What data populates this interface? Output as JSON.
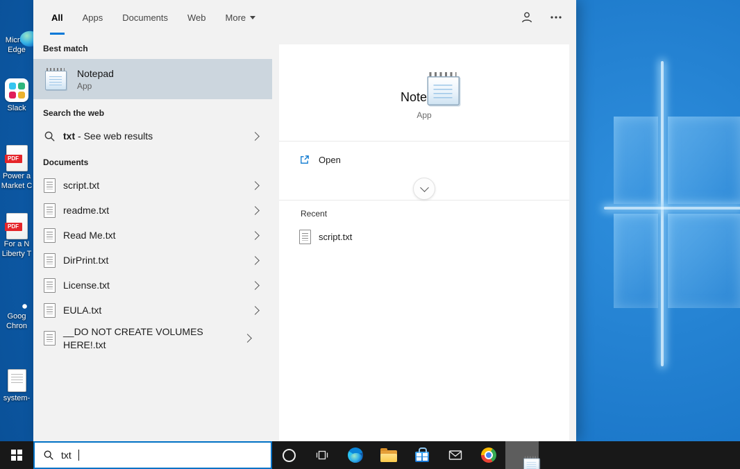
{
  "colors": {
    "accent": "#0078d7",
    "best_match_highlight": "#ccd6de",
    "taskbar": "#181818"
  },
  "header": {
    "tabs": [
      {
        "label": "All"
      },
      {
        "label": "Apps"
      },
      {
        "label": "Documents"
      },
      {
        "label": "Web"
      },
      {
        "label": "More"
      }
    ],
    "active_tab": "All",
    "icons": [
      "signin-icon",
      "ellipsis-icon"
    ]
  },
  "left_pane": {
    "best_match": {
      "label": "Best match",
      "item": {
        "title": "Notepad",
        "subtitle": "App",
        "icon": "notepad-icon"
      }
    },
    "search_the_web": {
      "label": "Search the web",
      "item": {
        "query": "txt",
        "rest": " - See web results",
        "icon": "search-icon"
      }
    },
    "documents": {
      "label": "Documents",
      "items": [
        {
          "title": "script.txt",
          "icon": "text-file-icon"
        },
        {
          "title": "readme.txt",
          "icon": "text-file-icon"
        },
        {
          "title": "Read Me.txt",
          "icon": "text-file-icon"
        },
        {
          "title": "DirPrint.txt",
          "icon": "text-file-icon"
        },
        {
          "title": "License.txt",
          "icon": "text-file-icon"
        },
        {
          "title": "EULA.txt",
          "icon": "text-file-icon"
        },
        {
          "title": "__DO NOT CREATE VOLUMES HERE!.txt",
          "icon": "text-file-icon"
        }
      ]
    }
  },
  "preview_pane": {
    "title": "Notepad",
    "subtitle": "App",
    "open_label": "Open",
    "open_icon": "open-external-icon",
    "expander_icon": "chevron-down-icon",
    "recent_label": "Recent",
    "recent_items": [
      {
        "title": "script.txt",
        "icon": "text-file-icon"
      }
    ]
  },
  "taskbar": {
    "search_value": "txt",
    "buttons": [
      "start",
      "search",
      "cortana",
      "task-view",
      "edge",
      "file-explorer",
      "microsoft-store",
      "mail",
      "chrome",
      "notepad"
    ]
  },
  "desktop": {
    "pdf_badge": "PDF",
    "icons": [
      {
        "name": "microsoft-edge",
        "label_lines": [
          "Micros",
          "Edge"
        ]
      },
      {
        "name": "slack",
        "label_lines": [
          "Slack",
          ""
        ]
      },
      {
        "name": "pdf-document",
        "label_lines": [
          "Power a",
          "Market C"
        ]
      },
      {
        "name": "pdf-document",
        "label_lines": [
          "For a N",
          "Liberty T"
        ]
      },
      {
        "name": "google-chrome",
        "label_lines": [
          "Goog",
          "Chron"
        ]
      },
      {
        "name": "system-file",
        "label_lines": [
          "system-",
          ""
        ]
      }
    ]
  }
}
